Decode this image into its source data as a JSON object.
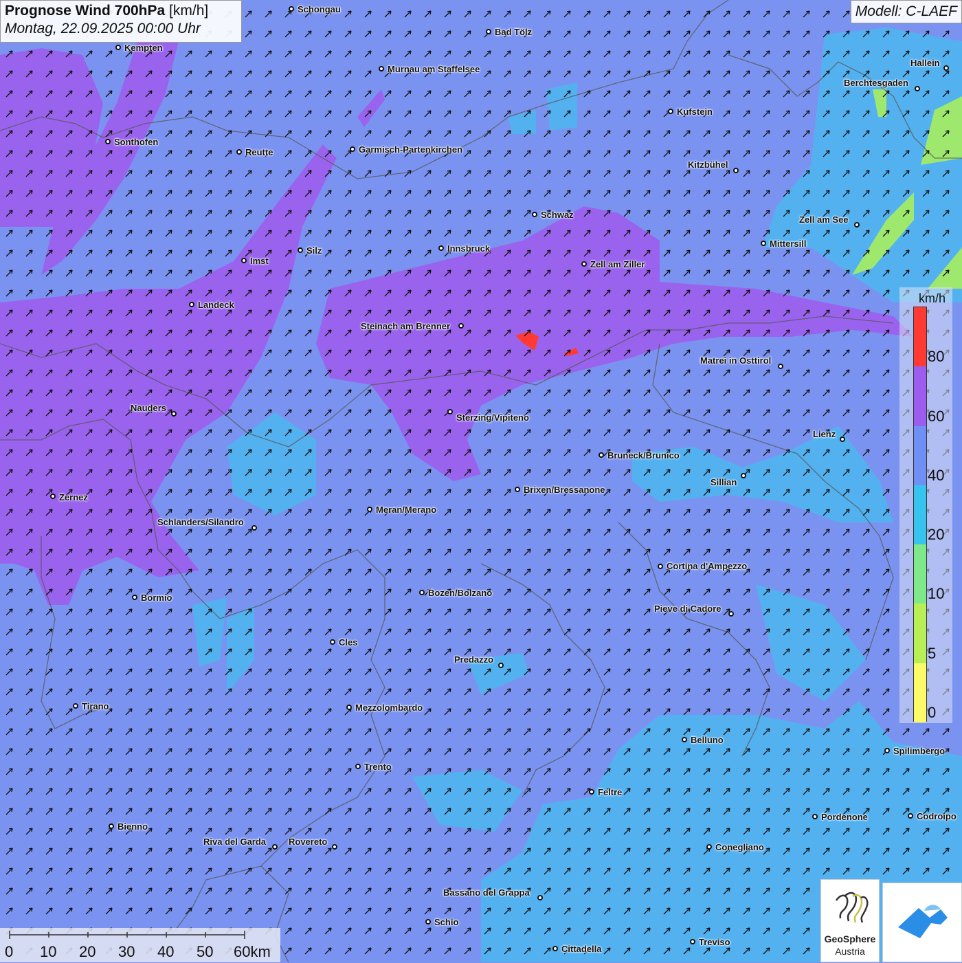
{
  "header": {
    "title_bold": "Prognose Wind 700hPa",
    "title_unit": "[km/h]",
    "datetime": "Montag, 22.09.2025 00:00 Uhr",
    "model": "Modell: C-LAEF"
  },
  "legend": {
    "unit": "km/h",
    "labels": [
      "80",
      "60",
      "40",
      "20",
      "10",
      "5",
      "0"
    ],
    "colors": [
      "#ff3a33",
      "#9d5cf0",
      "#6f8ff5",
      "#36c3ee",
      "#7ee88a",
      "#b7ef55",
      "#fcfa66"
    ]
  },
  "scale_bar": {
    "labels": [
      "0",
      "10",
      "20",
      "30",
      "40",
      "50",
      "60km"
    ]
  },
  "logos": {
    "geosphere_line1": "GeoSphere",
    "geosphere_line2": "Austria"
  },
  "wind": {
    "direction": "south-west",
    "arrow_icon": "wind-arrow-icon"
  },
  "cities": [
    {
      "name": "Schongau"
    },
    {
      "name": "Bad Tölz"
    },
    {
      "name": "Kempten"
    },
    {
      "name": "Murnau am Staffelsee"
    },
    {
      "name": "Hallein"
    },
    {
      "name": "Berchtesgaden"
    },
    {
      "name": "Kufstein"
    },
    {
      "name": "Sonthofen"
    },
    {
      "name": "Reutte"
    },
    {
      "name": "Garmisch-Partenkirchen"
    },
    {
      "name": "Kitzbühel"
    },
    {
      "name": "Schwaz"
    },
    {
      "name": "Zell am See"
    },
    {
      "name": "Mittersill"
    },
    {
      "name": "Innsbruck"
    },
    {
      "name": "Silz"
    },
    {
      "name": "Imst"
    },
    {
      "name": "Zell am Ziller"
    },
    {
      "name": "Landeck"
    },
    {
      "name": "Steinach am Brenner"
    },
    {
      "name": "Matrei in Osttirol"
    },
    {
      "name": "Nauders"
    },
    {
      "name": "Sterzing/Vipiteno"
    },
    {
      "name": "Lienz"
    },
    {
      "name": "Bruneck/Brunico"
    },
    {
      "name": "Sillian"
    },
    {
      "name": "Zernez"
    },
    {
      "name": "Brixen/Bressanone"
    },
    {
      "name": "Meran/Merano"
    },
    {
      "name": "Schlanders/Silandro"
    },
    {
      "name": "Cortina d'Ampezzo"
    },
    {
      "name": "Bozen/Bolzano"
    },
    {
      "name": "Bormio"
    },
    {
      "name": "Pieve di Cadore"
    },
    {
      "name": "Cles"
    },
    {
      "name": "Predazzo"
    },
    {
      "name": "Tirano"
    },
    {
      "name": "Mezzolombardo"
    },
    {
      "name": "Belluno"
    },
    {
      "name": "Spilimbergo"
    },
    {
      "name": "Trento"
    },
    {
      "name": "Feltre"
    },
    {
      "name": "Pordenone"
    },
    {
      "name": "Codroipo"
    },
    {
      "name": "Bienno"
    },
    {
      "name": "Riva del Garda"
    },
    {
      "name": "Rovereto"
    },
    {
      "name": "Conegliano"
    },
    {
      "name": "Bassano del Grappa"
    },
    {
      "name": "Schio"
    },
    {
      "name": "Treviso"
    },
    {
      "name": "Cittadella"
    }
  ]
}
